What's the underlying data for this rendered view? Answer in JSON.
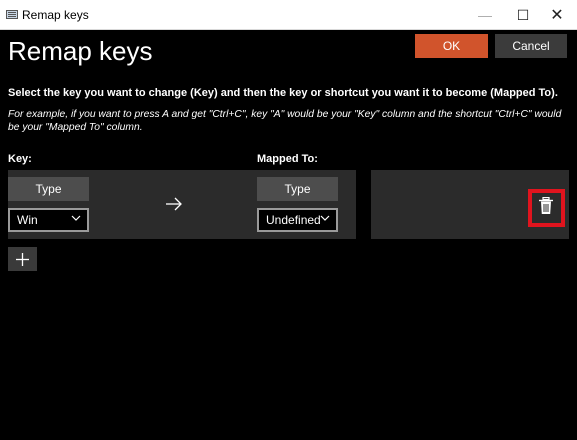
{
  "window": {
    "title": "Remap keys",
    "minimize_glyph": "—",
    "maximize_glyph": "☐",
    "close_glyph": "✕"
  },
  "header": {
    "title": "Remap keys",
    "ok_label": "OK",
    "cancel_label": "Cancel",
    "ok_color": "#d1542c"
  },
  "instructions": {
    "main": "Select the key you want to change (Key) and then the key or shortcut you want it to become (Mapped To).",
    "example": "For example, if you want to press A and get \"Ctrl+C\", key \"A\" would be your \"Key\" column and the shortcut \"Ctrl+C\" would be your \"Mapped To\" column."
  },
  "columns": {
    "key": "Key:",
    "mapped_to": "Mapped To:"
  },
  "rows": [
    {
      "key_type_label": "Type",
      "key_value": "Win",
      "mapped_type_label": "Type",
      "mapped_value": "Undefined",
      "arrow_icon": "arrow-right-icon",
      "delete_icon": "trash-icon"
    }
  ],
  "add_icon": "plus-icon",
  "highlight_color": "#e0141e"
}
